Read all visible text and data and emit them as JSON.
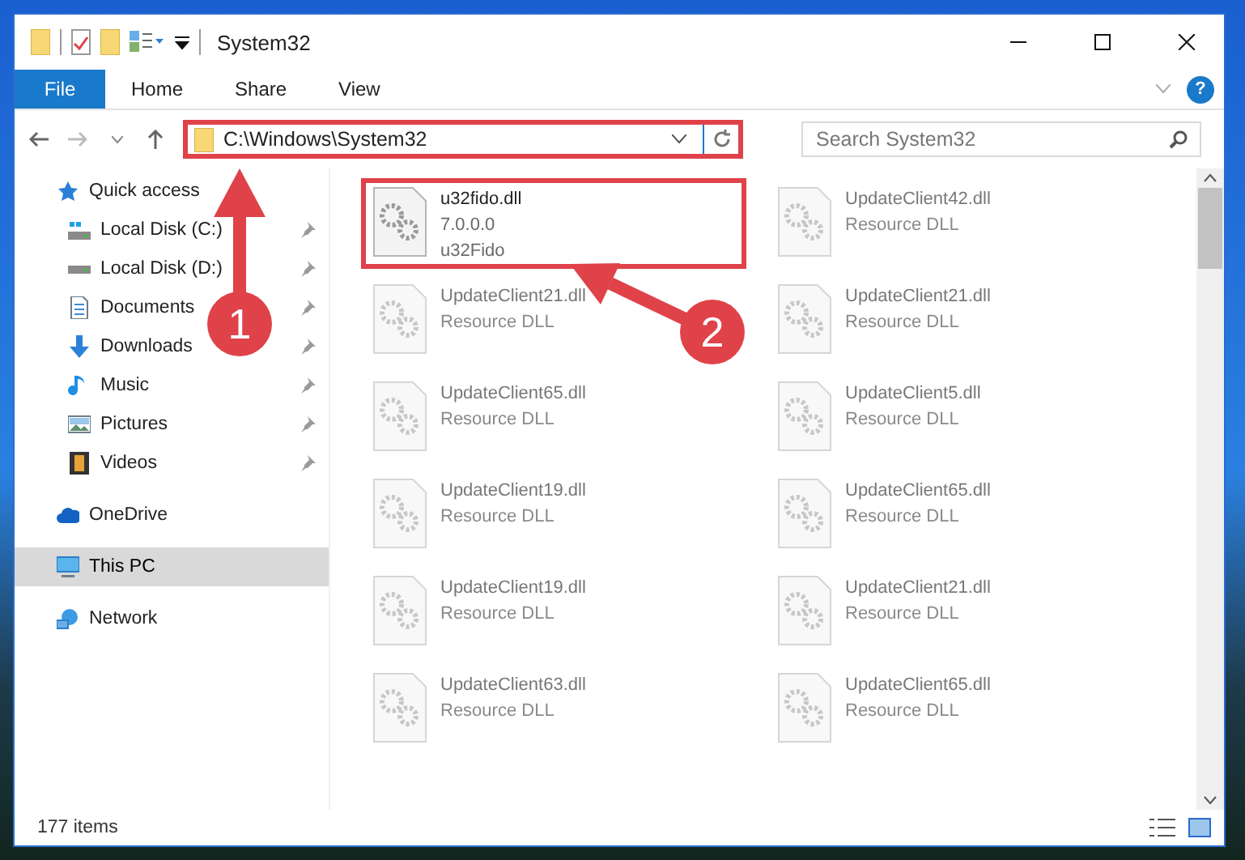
{
  "window": {
    "title": "System32"
  },
  "ribbon_tabs": [
    {
      "label": "File",
      "selected": true
    },
    {
      "label": "Home",
      "selected": false
    },
    {
      "label": "Share",
      "selected": false
    },
    {
      "label": "View",
      "selected": false
    }
  ],
  "help": {
    "label": "?"
  },
  "address": {
    "value": "C:\\Windows\\System32",
    "highlighted": true
  },
  "search": {
    "placeholder": "Search System32"
  },
  "nav": [
    {
      "label": "Quick access",
      "kind": "star",
      "selected": false,
      "children": [
        {
          "label": "Local Disk (C:)",
          "kind": "drive-windows",
          "pinned": true,
          "selected": false
        },
        {
          "label": "Local Disk (D:)",
          "kind": "drive",
          "pinned": true,
          "selected": false
        },
        {
          "label": "Documents",
          "kind": "document",
          "pinned": true,
          "selected": false
        },
        {
          "label": "Downloads",
          "kind": "download",
          "pinned": true,
          "selected": false
        },
        {
          "label": "Music",
          "kind": "music",
          "pinned": true,
          "selected": false
        },
        {
          "label": "Pictures",
          "kind": "picture",
          "pinned": true,
          "selected": false
        },
        {
          "label": "Videos",
          "kind": "video",
          "pinned": true,
          "selected": false
        }
      ]
    },
    {
      "label": "OneDrive",
      "kind": "cloud",
      "selected": false
    },
    {
      "label": "This PC",
      "kind": "computer",
      "selected": true
    },
    {
      "label": "Network",
      "kind": "network",
      "selected": false
    }
  ],
  "files": [
    {
      "name": "u32fido.dll",
      "lines": [
        "7.0.0.0",
        "u32Fido"
      ],
      "highlighted": true,
      "dimmed": false
    },
    {
      "name": "UpdateClient42.dll",
      "lines": [
        "Resource DLL"
      ],
      "highlighted": false,
      "dimmed": true
    },
    {
      "name": "UpdateClient21.dll",
      "lines": [
        "Resource DLL"
      ],
      "highlighted": false,
      "dimmed": true
    },
    {
      "name": "UpdateClient21.dll",
      "lines": [
        "Resource DLL"
      ],
      "highlighted": false,
      "dimmed": true
    },
    {
      "name": "UpdateClient65.dll",
      "lines": [
        "Resource DLL"
      ],
      "highlighted": false,
      "dimmed": true
    },
    {
      "name": "UpdateClient5.dll",
      "lines": [
        "Resource DLL"
      ],
      "highlighted": false,
      "dimmed": true
    },
    {
      "name": "UpdateClient19.dll",
      "lines": [
        "Resource DLL"
      ],
      "highlighted": false,
      "dimmed": true
    },
    {
      "name": "UpdateClient65.dll",
      "lines": [
        "Resource DLL"
      ],
      "highlighted": false,
      "dimmed": true
    },
    {
      "name": "UpdateClient19.dll",
      "lines": [
        "Resource DLL"
      ],
      "highlighted": false,
      "dimmed": true
    },
    {
      "name": "UpdateClient21.dll",
      "lines": [
        "Resource DLL"
      ],
      "highlighted": false,
      "dimmed": true
    },
    {
      "name": "UpdateClient63.dll",
      "lines": [
        "Resource DLL"
      ],
      "highlighted": false,
      "dimmed": true
    },
    {
      "name": "UpdateClient65.dll",
      "lines": [
        "Resource DLL"
      ],
      "highlighted": false,
      "dimmed": true
    }
  ],
  "status_bar": {
    "count": "177 items"
  },
  "annotations": [
    {
      "label": "1"
    },
    {
      "label": "2"
    }
  ]
}
